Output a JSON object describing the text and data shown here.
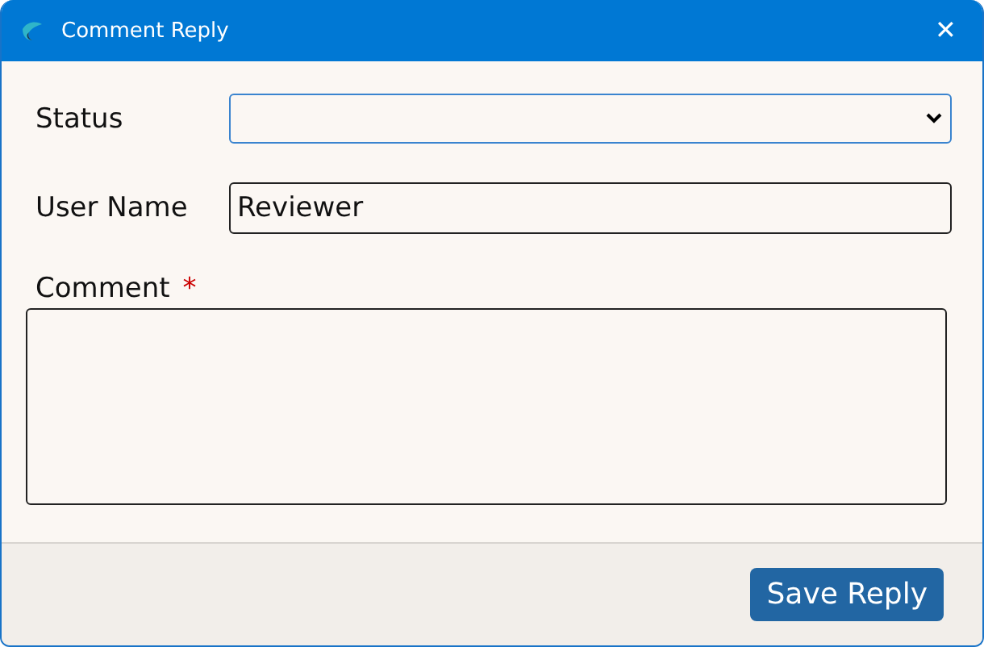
{
  "window": {
    "title": "Comment Reply",
    "close": "✕"
  },
  "form": {
    "status": {
      "label": "Status",
      "focused": true
    },
    "user_name": {
      "label": "User Name",
      "value": "Reviewer"
    },
    "comment": {
      "label": "Comment",
      "required_mark": "*"
    }
  },
  "buttons": {
    "save": "Save Reply"
  }
}
